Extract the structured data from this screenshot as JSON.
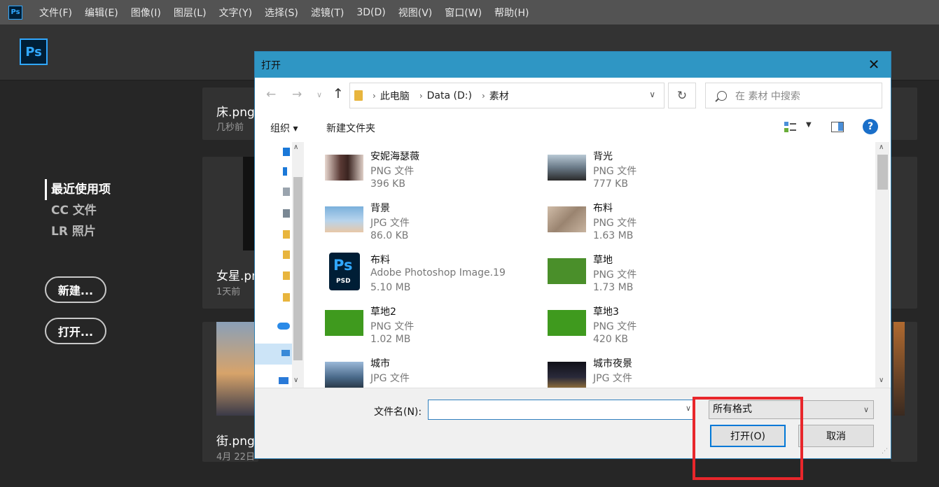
{
  "app": {
    "ps_icon": "Ps",
    "menu": [
      "文件(F)",
      "编辑(E)",
      "图像(I)",
      "图层(L)",
      "文字(Y)",
      "选择(S)",
      "滤镜(T)",
      "3D(D)",
      "视图(V)",
      "窗口(W)",
      "帮助(H)"
    ],
    "logo": "Ps"
  },
  "home": {
    "nav": [
      {
        "label": "最近使用项",
        "active": true
      },
      {
        "label": "CC 文件",
        "active": false
      },
      {
        "label": "LR 照片",
        "active": false
      }
    ],
    "new_label": "新建...",
    "open_label": "打开...",
    "cards": [
      {
        "title": "床.png",
        "sub": "几秒前"
      },
      {
        "title": "女星.png",
        "sub": "1天前"
      },
      {
        "title": "街.png",
        "sub": "4月 22日"
      }
    ]
  },
  "dialog": {
    "title": "打开",
    "close_icon": "close-icon",
    "breadcrumb": [
      "此电脑",
      "Data (D:)",
      "素材"
    ],
    "search_placeholder": "在 素材 中搜索",
    "toolbar": {
      "organize": "组织 ▾",
      "new_folder": "新建文件夹",
      "help": "?"
    },
    "files": [
      {
        "name": "安妮海瑟薇",
        "type": "PNG 文件",
        "size": "396 KB",
        "thumb_color": "#5a3a35"
      },
      {
        "name": "背光",
        "type": "PNG 文件",
        "size": "777 KB",
        "thumb_color": "#8a9aa8"
      },
      {
        "name": "背景",
        "type": "JPG 文件",
        "size": "86.0 KB",
        "thumb_color": "#9ec3e0"
      },
      {
        "name": "布料",
        "type": "PNG 文件",
        "size": "1.63 MB",
        "thumb_color": "#b09a85"
      },
      {
        "name": "布料",
        "type": "Adobe Photoshop Image.19",
        "size": "5.10 MB",
        "thumb_color": "#001e36",
        "psd": true,
        "psd_ps": "Ps",
        "psd_ext": "PSD"
      },
      {
        "name": "草地",
        "type": "PNG 文件",
        "size": "1.73 MB",
        "thumb_color": "#4a8f2a"
      },
      {
        "name": "草地2",
        "type": "PNG 文件",
        "size": "1.02 MB",
        "thumb_color": "#3f9a1e"
      },
      {
        "name": "草地3",
        "type": "PNG 文件",
        "size": "420 KB",
        "thumb_color": "#3f9a1e"
      },
      {
        "name": "城市",
        "type": "JPG 文件",
        "size": "",
        "thumb_color": "#4a6a8a"
      },
      {
        "name": "城市夜景",
        "type": "JPG 文件",
        "size": "",
        "thumb_color": "#1e1e2e"
      }
    ],
    "filename_label": "文件名(N):",
    "filename_value": "",
    "format": "所有格式",
    "open_button": "打开(O)",
    "cancel_button": "取消"
  },
  "colors": {
    "ps_blue": "#31a8ff",
    "title_bar": "#2f96c4",
    "highlight": "#e8262b"
  }
}
